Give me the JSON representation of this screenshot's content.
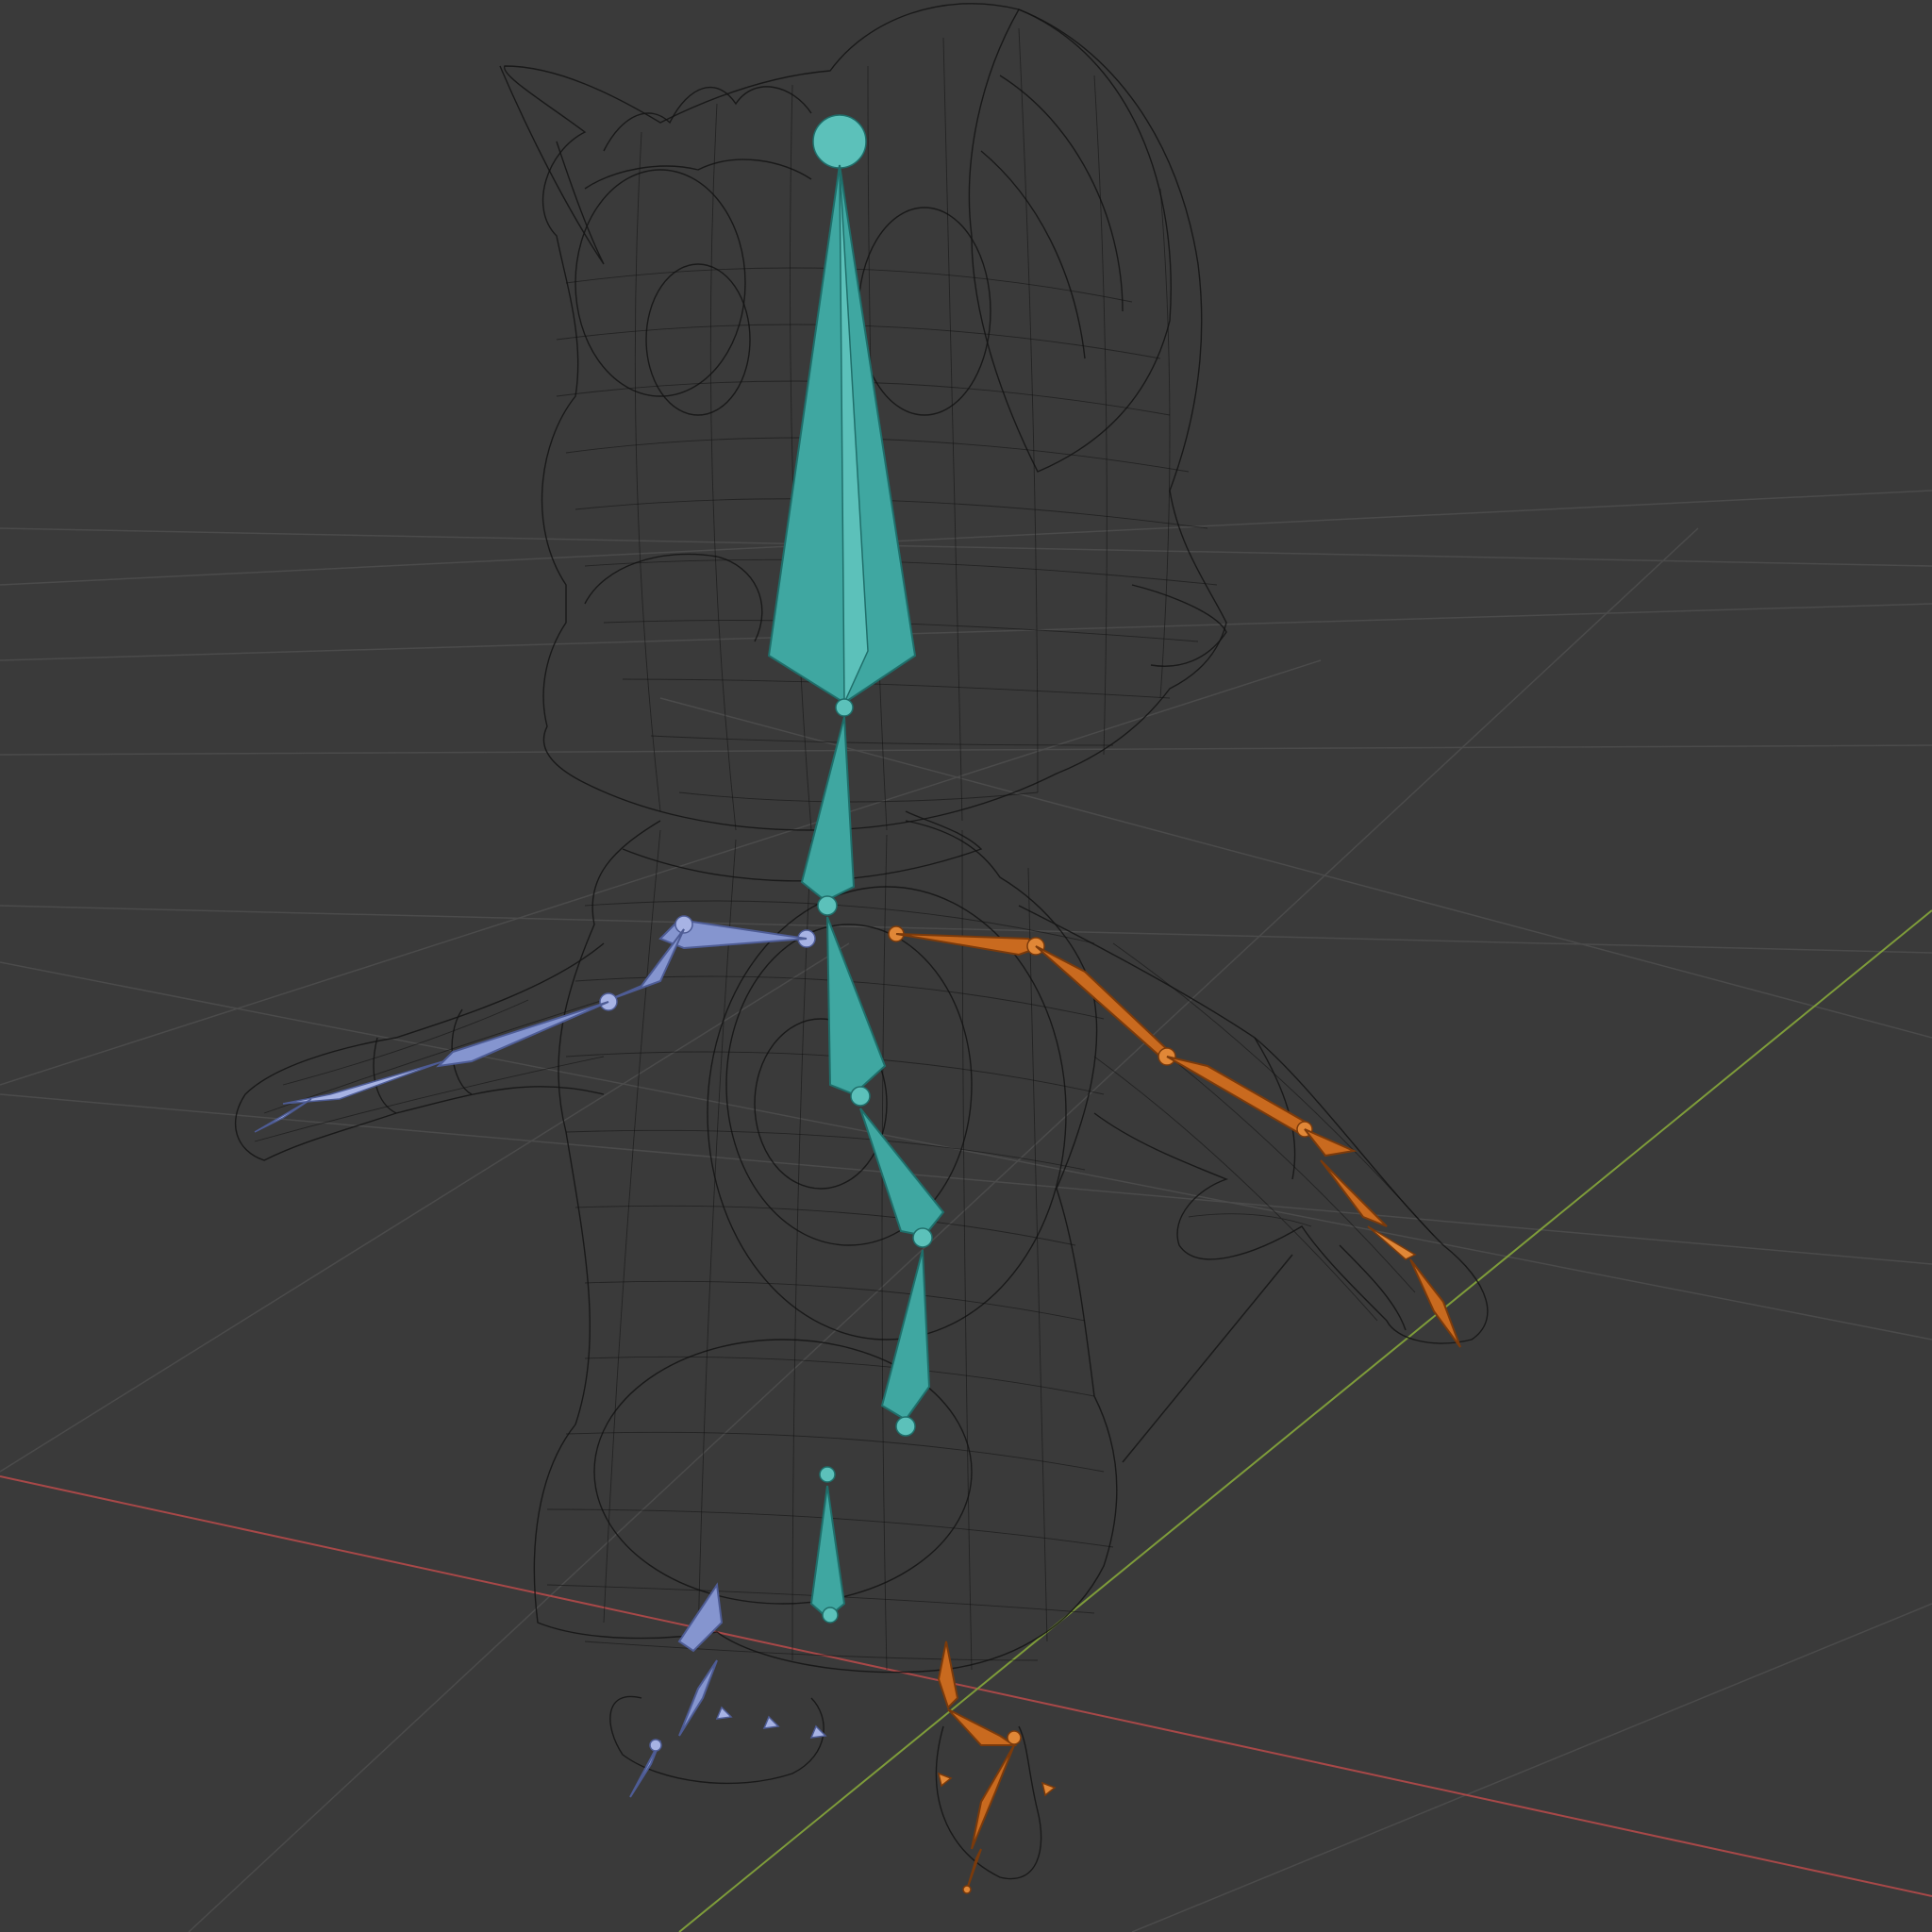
{
  "viewport": {
    "background": "#3a3a3a",
    "grid_color": "#4a4a4a",
    "axis_x_color": "#b04646",
    "axis_y_color": "#7a9a3a"
  },
  "armature": {
    "spine_color": "#3fa7a1",
    "left_side_color": "#8595cf",
    "right_side_color": "#c96a1f"
  },
  "mesh": {
    "wire_color": "#141414"
  }
}
